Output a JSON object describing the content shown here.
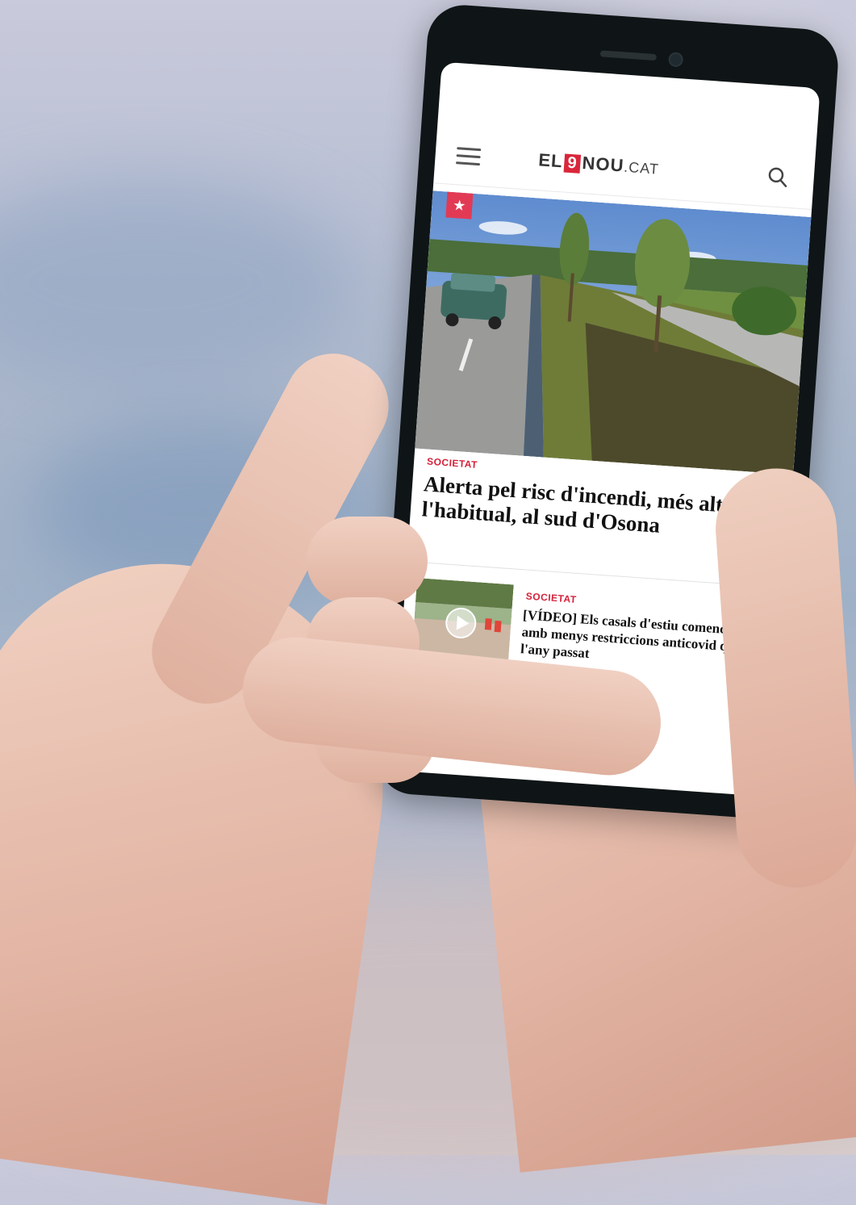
{
  "app": {
    "logo": {
      "left": "EL",
      "nine": "9",
      "right": "NOU",
      "suffix": ".CAT"
    }
  },
  "header": {
    "menu_icon": "hamburger-menu-icon",
    "search_icon": "search-icon"
  },
  "featured": {
    "badge_icon": "star-icon",
    "badge_glyph": "★",
    "category": "SOCIETAT",
    "title": "Alerta pel risc d'incendi, més alt de l'habitual, al sud d'Osona"
  },
  "articles": [
    {
      "category": "SOCIETAT",
      "title": "[VÍDEO] Els casals d'estiu comencen amb menys restriccions anticovid que l'any passat",
      "thumb_icon": "play-video-icon"
    }
  ],
  "colors": {
    "accent": "#d9263b",
    "badge": "#e23a55",
    "text": "#111111"
  }
}
